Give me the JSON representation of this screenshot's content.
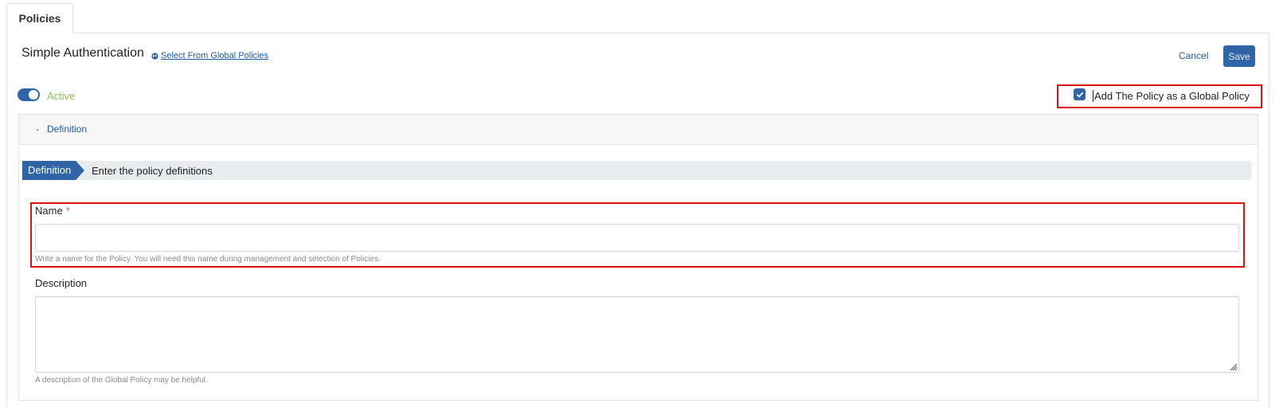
{
  "tabs": [
    {
      "label": "Policies"
    }
  ],
  "header": {
    "title": "Simple Authentication",
    "global_link": "Select From Global Policies",
    "cancel_label": "Cancel",
    "save_label": "Save"
  },
  "status": {
    "active_label": "Active",
    "active": true
  },
  "global_policy": {
    "label": "Add The Policy as a Global Policy",
    "checked": true
  },
  "accordion": {
    "toggle_symbol": "-",
    "title": "Definition"
  },
  "step": {
    "chip_label": "Definition",
    "description": "Enter the policy definitions"
  },
  "form": {
    "name": {
      "label": "Name",
      "required_mark": "*",
      "value": "",
      "help": "Write a name for the Policy. You will need this name during management and selection of Policies."
    },
    "description": {
      "label": "Description",
      "value": "",
      "help": "A description of the Global Policy may be helpful."
    }
  },
  "colors": {
    "primary": "#2f65a7",
    "link": "#1f5aa6",
    "active_green": "#8cc157",
    "highlight_red": "#e01010",
    "required_red": "#e06060"
  }
}
